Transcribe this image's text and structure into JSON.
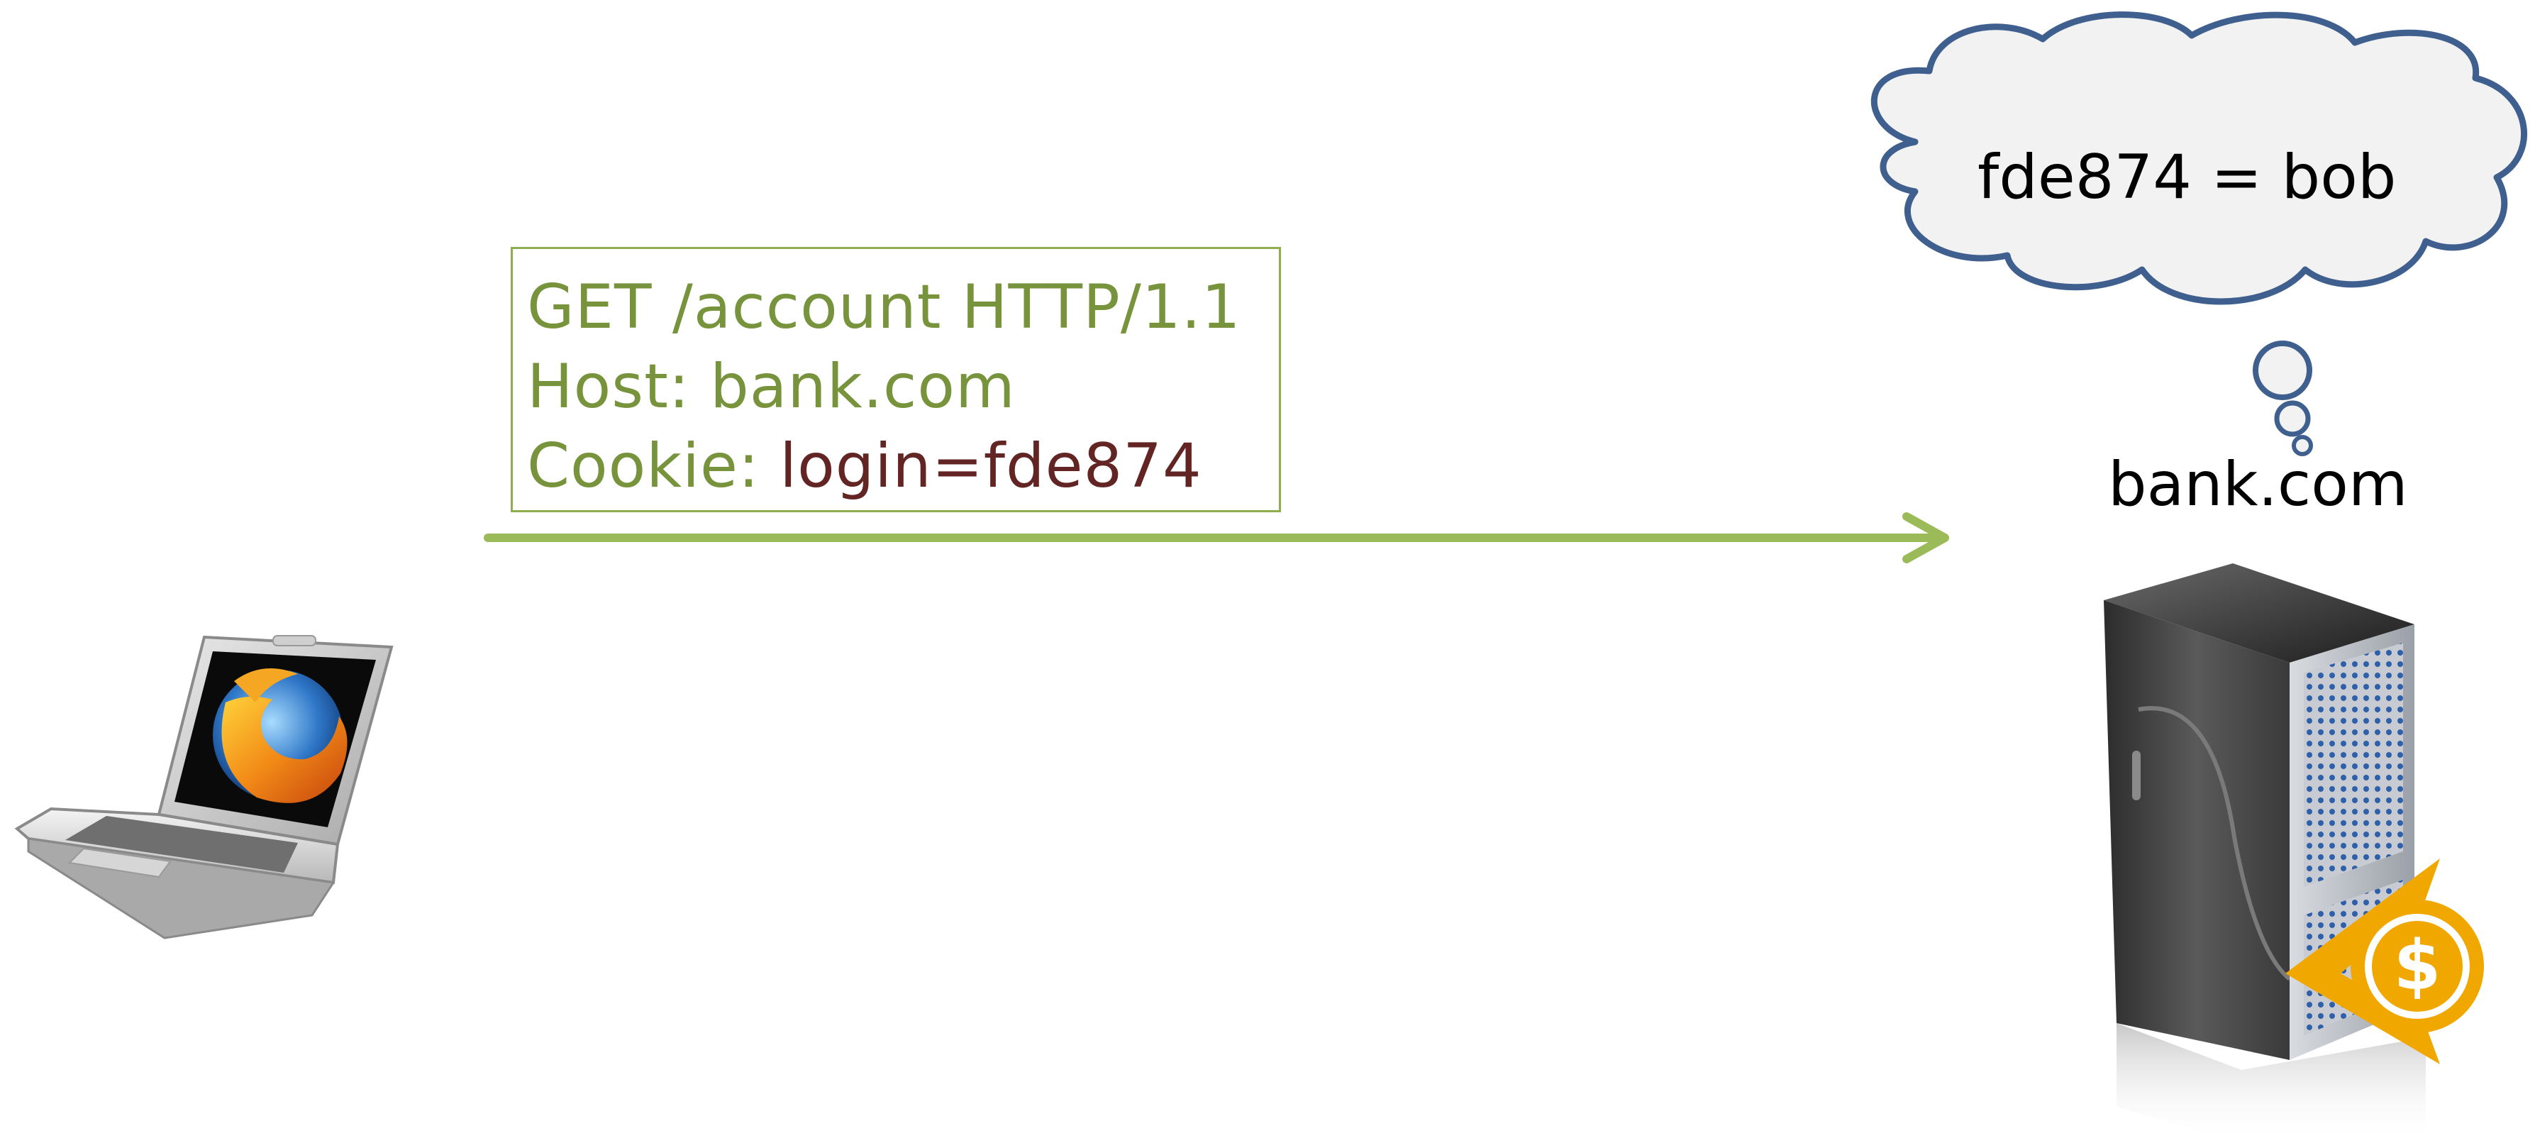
{
  "request": {
    "request_line": "GET /account HTTP/1.1",
    "host_line": "Host:  bank.com",
    "cookie_label": "Cookie: ",
    "cookie_value": "login=fde874"
  },
  "server": {
    "name": "bank.com",
    "thought": "fde874 = bob"
  },
  "icons": {
    "client": "laptop-firefox-icon",
    "server": "server-tower-icon",
    "money": "dollar-coin-icon"
  },
  "colors": {
    "arrow": "#9bbb59",
    "request_text": "#77933c",
    "request_border": "#8fae4f",
    "cookie_value": "#632523",
    "cloud_outline": "#3f5f8f",
    "cloud_fill": "#f2f2f2",
    "coin": "#f0a800"
  }
}
